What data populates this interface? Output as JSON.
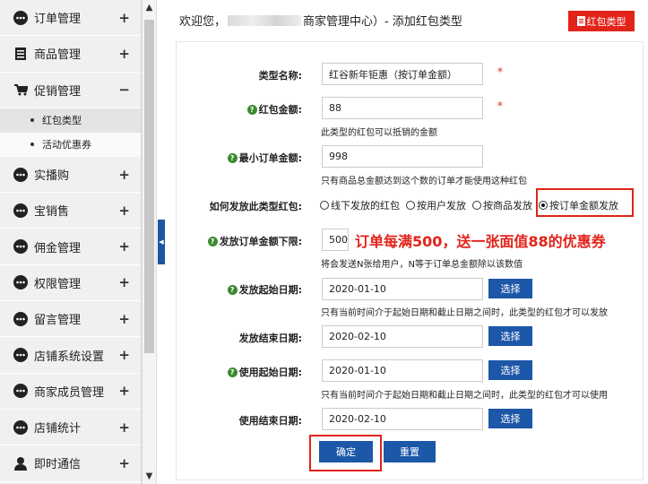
{
  "sidebar": {
    "items": [
      {
        "label": "订单管理",
        "toggle": "+",
        "icon": "dots-icon"
      },
      {
        "label": "商品管理",
        "toggle": "+",
        "icon": "document-icon"
      },
      {
        "label": "促销管理",
        "toggle": "−",
        "icon": "cart-icon"
      },
      {
        "label": "实播购",
        "toggle": "+",
        "icon": "dots-icon"
      },
      {
        "label": "宝销售",
        "toggle": "+",
        "icon": "dots-icon"
      },
      {
        "label": "佣金管理",
        "toggle": "+",
        "icon": "dots-icon"
      },
      {
        "label": "权限管理",
        "toggle": "+",
        "icon": "dots-icon"
      },
      {
        "label": "留言管理",
        "toggle": "+",
        "icon": "dots-icon"
      },
      {
        "label": "店铺系统设置",
        "toggle": "+",
        "icon": "dots-icon"
      },
      {
        "label": "商家成员管理",
        "toggle": "+",
        "icon": "dots-icon"
      },
      {
        "label": "店铺统计",
        "toggle": "+",
        "icon": "dots-icon"
      },
      {
        "label": "即时通信",
        "toggle": "+",
        "icon": "person-icon"
      }
    ],
    "sub_items": [
      "红包类型",
      "活动优惠券"
    ]
  },
  "header": {
    "welcome_prefix": "欢迎您，",
    "welcome_suffix": "商家管理中心）- 添加红包类型",
    "button_label": "红包类型"
  },
  "form": {
    "type_name": {
      "label": "类型名称:",
      "value": "红谷新年钜惠（按订单金额）",
      "required": "*"
    },
    "amount": {
      "label": "红包金额:",
      "value": "88",
      "required": "*",
      "hint": "此类型的红包可以抵销的金额"
    },
    "min_order": {
      "label": "最小订单金额:",
      "value": "998",
      "hint": "只有商品总金额达到这个数的订单才能使用这种红包"
    },
    "send_method": {
      "label": "如何发放此类型红包:",
      "options": [
        {
          "label": "线下发放的红包",
          "selected": false
        },
        {
          "label": "按用户发放",
          "selected": false
        },
        {
          "label": "按商品发放",
          "selected": false
        },
        {
          "label": "按订单金额发放",
          "selected": true
        }
      ]
    },
    "order_lower": {
      "label": "发放订单金额下限:",
      "value": "500",
      "hint": "将会发送N张给用户，N等于订单总金额除以该数值"
    },
    "annotation": "订单每满500，送一张面值88的优惠券",
    "send_start": {
      "label": "发放起始日期:",
      "value": "2020-01-10",
      "button": "选择",
      "hint": "只有当前时间介于起始日期和截止日期之间时，此类型的红包才可以发放"
    },
    "send_end": {
      "label": "发放结束日期:",
      "value": "2020-02-10",
      "button": "选择"
    },
    "use_start": {
      "label": "使用起始日期:",
      "value": "2020-01-10",
      "button": "选择",
      "hint": "只有当前时间介于起始日期和截止日期之间时，此类型的红包才可以使用"
    },
    "use_end": {
      "label": "使用结束日期:",
      "value": "2020-02-10",
      "button": "选择"
    },
    "submit_label": "确定",
    "reset_label": "重置"
  },
  "colors": {
    "accent_blue": "#1d57a8",
    "accent_red": "#e2231a",
    "help_green": "#3a8a2e"
  }
}
